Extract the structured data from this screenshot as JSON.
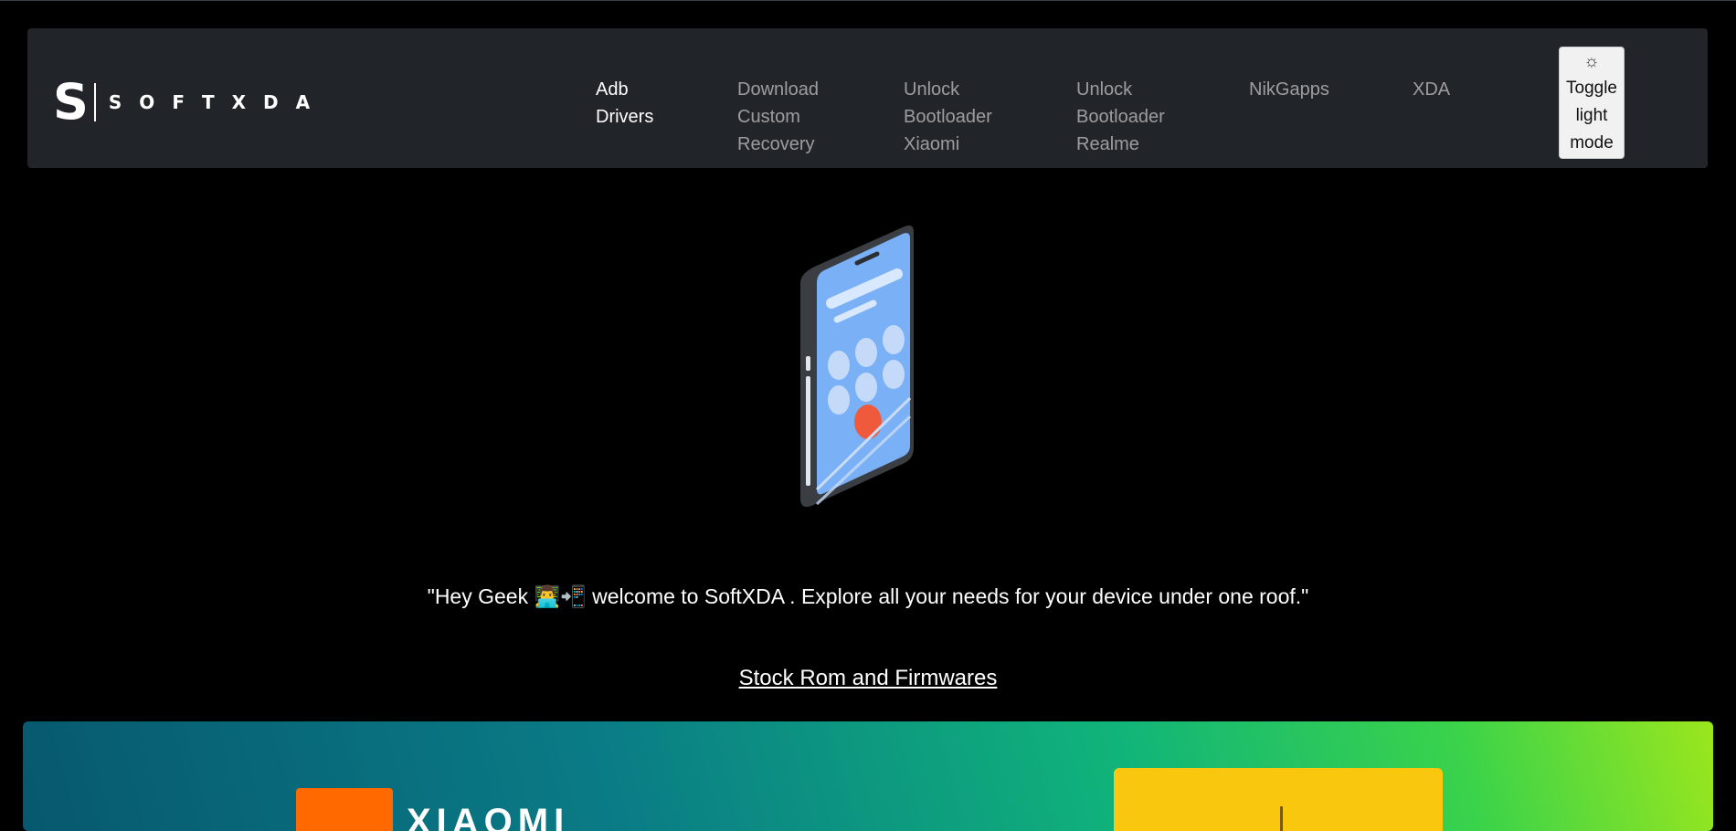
{
  "brand": {
    "logo_letter": "S",
    "logo_text": "SOFTXDA"
  },
  "nav": {
    "items": [
      {
        "label": "Adb\nDrivers",
        "active": true
      },
      {
        "label": "Download\nCustom\nRecovery",
        "active": false
      },
      {
        "label": "Unlock\nBootloader\nXiaomi",
        "active": false
      },
      {
        "label": "Unlock\nBootloader\nRealme",
        "active": false
      },
      {
        "label": "NikGapps",
        "active": false
      },
      {
        "label": "XDA",
        "active": false
      }
    ],
    "toggle": {
      "icon": "☼",
      "label": "Toggle light mode"
    }
  },
  "hero": {
    "tagline": "\"Hey Geek 👨‍💻📲 welcome to SoftXDA . Explore all your needs for your device under one roof.\"",
    "stock_link": "Stock Rom and Firmwares"
  },
  "banner": {
    "brand_text": "XIAOMI"
  },
  "colors": {
    "background": "#000000",
    "navbar": "#212529",
    "phone_screen": "#7ab0f5",
    "mi_orange": "#ff6900",
    "yellow": "#f9c80e"
  }
}
